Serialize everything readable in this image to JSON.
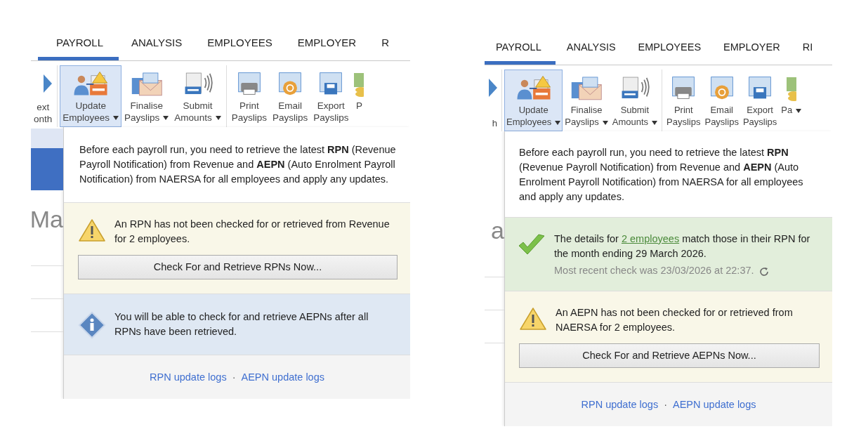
{
  "panels": [
    {
      "tabs": [
        {
          "label": "PAYROLL",
          "selected": true
        },
        {
          "label": "ANALYSIS",
          "selected": false
        },
        {
          "label": "EMPLOYEES",
          "selected": false
        },
        {
          "label": "EMPLOYER",
          "selected": false
        },
        {
          "label": "R",
          "selected": false
        }
      ],
      "ribbon": [
        [
          {
            "kind": "arrow",
            "lines": [
              "ext",
              "onth"
            ],
            "dropdown": false,
            "selected": false
          }
        ],
        [
          {
            "kind": "people",
            "lines": [
              "Update",
              "Employees"
            ],
            "dropdown": true,
            "selected": true
          },
          {
            "kind": "envelope",
            "lines": [
              "Finalise",
              "Payslips"
            ],
            "dropdown": true,
            "selected": false
          },
          {
            "kind": "signal",
            "lines": [
              "Submit",
              "Amounts"
            ],
            "dropdown": true,
            "selected": false
          }
        ],
        [
          {
            "kind": "printer",
            "lines": [
              "Print",
              "Payslips"
            ],
            "dropdown": false,
            "selected": false
          },
          {
            "kind": "email",
            "lines": [
              "Email",
              "Payslips"
            ],
            "dropdown": false,
            "selected": false
          },
          {
            "kind": "export",
            "lines": [
              "Export",
              "Payslips"
            ],
            "dropdown": false,
            "selected": false
          },
          {
            "kind": "coins",
            "lines": [
              "P"
            ],
            "dropdown": false,
            "selected": false
          }
        ]
      ],
      "background_heading": "Ma",
      "popup": {
        "intro": "Before each payroll run, you need to retrieve the latest **RPN** (Revenue Payroll Notification) from Revenue and **AEPN** (Auto Enrolment Payroll Notification) from NAERSA for all employees and apply any updates.",
        "sections": [
          {
            "kind": "warning",
            "text": "An RPN has not been checked for or retrieved from Revenue for 2 employees.",
            "button": "Check For and Retrieve RPNs Now..."
          },
          {
            "kind": "info",
            "text": "You will be able to check for and retrieve AEPNs after all RPNs have been retrieved."
          }
        ],
        "footer_links": [
          "RPN update logs",
          "AEPN update logs"
        ],
        "separator": "·"
      }
    },
    {
      "tabs": [
        {
          "label": "PAYROLL",
          "selected": true
        },
        {
          "label": "ANALYSIS",
          "selected": false
        },
        {
          "label": "EMPLOYEES",
          "selected": false
        },
        {
          "label": "EMPLOYER",
          "selected": false
        },
        {
          "label": "RI",
          "selected": false
        }
      ],
      "ribbon": [
        [
          {
            "kind": "arrow",
            "lines": [
              "h"
            ],
            "dropdown": false,
            "selected": false
          }
        ],
        [
          {
            "kind": "people",
            "lines": [
              "Update",
              "Employees"
            ],
            "dropdown": true,
            "selected": true
          },
          {
            "kind": "envelope",
            "lines": [
              "Finalise",
              "Payslips"
            ],
            "dropdown": true,
            "selected": false
          },
          {
            "kind": "signal",
            "lines": [
              "Submit",
              "Amounts"
            ],
            "dropdown": true,
            "selected": false
          }
        ],
        [
          {
            "kind": "printer",
            "lines": [
              "Print",
              "Payslips"
            ],
            "dropdown": false,
            "selected": false
          },
          {
            "kind": "email",
            "lines": [
              "Email",
              "Payslips"
            ],
            "dropdown": false,
            "selected": false
          },
          {
            "kind": "export",
            "lines": [
              "Export",
              "Payslips"
            ],
            "dropdown": false,
            "selected": false
          },
          {
            "kind": "coins",
            "lines": [
              "Pa"
            ],
            "dropdown": true,
            "selected": false
          }
        ]
      ],
      "background_heading": "a",
      "popup": {
        "intro": "Before each payroll run, you need to retrieve the latest **RPN** (Revenue Payroll Notification) from Revenue and **AEPN** (Auto Enrolment Payroll Notification) from NAERSA for all employees and apply any updates.",
        "sections": [
          {
            "kind": "success",
            "text_before": "The details for ",
            "link": "2 employees",
            "text_after": " match those in their RPN for the month ending 29 March 2026.",
            "note": "Most recent check was 23/03/2026 at 22:37."
          },
          {
            "kind": "warning",
            "text": "An AEPN has not been checked for or retrieved from NAERSA for 2 employees.",
            "button": "Check For and Retrieve AEPNs Now..."
          }
        ],
        "footer_links": [
          "RPN update logs",
          "AEPN update logs"
        ],
        "separator": "·"
      }
    }
  ]
}
